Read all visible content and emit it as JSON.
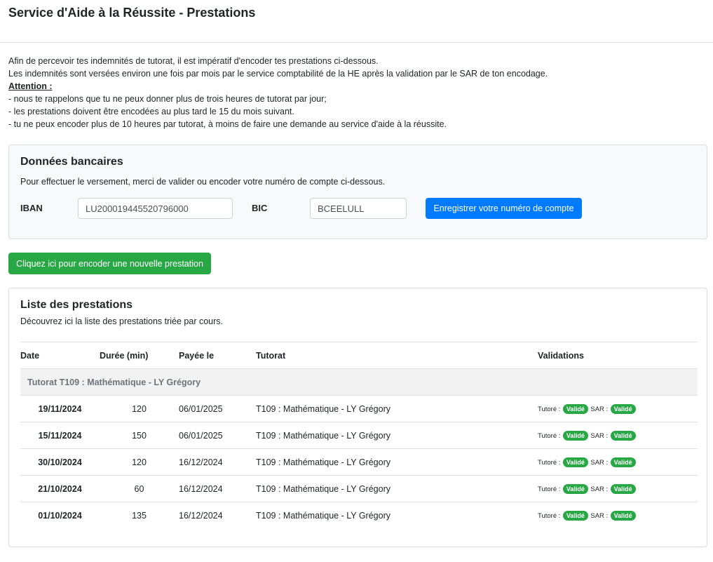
{
  "header": {
    "title": "Service d'Aide à la Réussite - Prestations"
  },
  "intro": {
    "line1": "Afin de percevoir tes indemnités de tutorat, il est impératif d'encoder tes prestations ci-dessous.",
    "line2": "Les indemnités sont versées environ une fois par mois par le service comptabilité de la HE après la validation par le SAR de ton encodage.",
    "attention": "Attention :",
    "rule1": "- nous te rappelons que tu ne peux donner plus de trois heures de tutorat par jour;",
    "rule2": "- les prestations doivent être encodées au plus tard le 15 du mois suivant.",
    "rule3": "- tu ne peux encoder plus de 10 heures par tutorat, à moins de faire une demande au service d'aide à la réussite."
  },
  "bank": {
    "title": "Données bancaires",
    "subtitle": "Pour effectuer le versement, merci de valider ou encoder votre numéro de compte ci-dessous.",
    "iban_label": "IBAN",
    "iban_value": "LU200019445520796000",
    "bic_label": "BIC",
    "bic_value": "BCEELULL",
    "save_label": "Enregistrer votre numéro de compte"
  },
  "new_prestation_label": "Cliquez ici pour encoder une nouvelle prestation",
  "list": {
    "title": "Liste des prestations",
    "subtitle": "Découvrez ici la liste des prestations triée par cours.",
    "columns": [
      "Date",
      "Durée (min)",
      "Payée le",
      "Tutorat",
      "Validations"
    ],
    "group_label": "Tutorat T109 : Mathématique - LY Grégory",
    "validation_tutore_label": "Tutoré :",
    "validation_sar_label": "SAR :",
    "rows": [
      {
        "date": "19/11/2024",
        "duree": "120",
        "payee": "06/01/2025",
        "tutorat": "T109 : Mathématique - LY Grégory",
        "tutore_status": "Validé",
        "sar_status": "Validé"
      },
      {
        "date": "15/11/2024",
        "duree": "150",
        "payee": "06/01/2025",
        "tutorat": "T109 : Mathématique - LY Grégory",
        "tutore_status": "Validé",
        "sar_status": "Validé"
      },
      {
        "date": "30/10/2024",
        "duree": "120",
        "payee": "16/12/2024",
        "tutorat": "T109 : Mathématique - LY Grégory",
        "tutore_status": "Validé",
        "sar_status": "Validé"
      },
      {
        "date": "21/10/2024",
        "duree": "60",
        "payee": "16/12/2024",
        "tutorat": "T109 : Mathématique - LY Grégory",
        "tutore_status": "Validé",
        "sar_status": "Validé"
      },
      {
        "date": "01/10/2024",
        "duree": "135",
        "payee": "16/12/2024",
        "tutorat": "T109 : Mathématique - LY Grégory",
        "tutore_status": "Validé",
        "sar_status": "Validé"
      }
    ]
  },
  "colors": {
    "primary": "#007bff",
    "success": "#28a745"
  }
}
